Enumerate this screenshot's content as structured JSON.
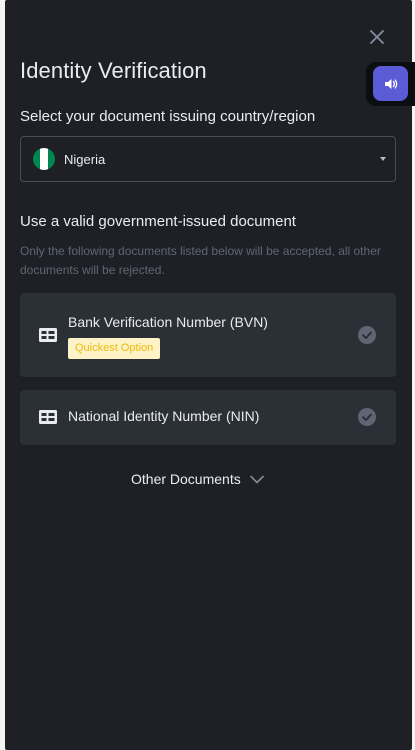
{
  "modal": {
    "title": "Identity Verification",
    "close_icon": "close-icon",
    "widget_icon": "speaker-icon"
  },
  "country": {
    "label": "Select your document issuing country/region",
    "selected": "Nigeria",
    "flag_icon": "nigeria-flag-icon",
    "flag_colors": [
      "#008751",
      "#ffffff",
      "#008751"
    ]
  },
  "documents": {
    "heading": "Use a valid government-issued document",
    "note": "Only the following documents listed below will be accepted, all other documents will be rejected.",
    "items": [
      {
        "name": "Bank Verification Number (BVN)",
        "badge": "Quickest Option",
        "icon": "id-card-icon"
      },
      {
        "name": "National Identity Number (NIN)",
        "icon": "id-card-icon"
      }
    ],
    "other_label": "Other Documents"
  },
  "colors": {
    "background": "#1e2026",
    "card": "#2b2f36",
    "badge_bg": "#fdf3c7",
    "badge_text": "#f0b90b",
    "accent_widget": "#5b5bd6"
  }
}
